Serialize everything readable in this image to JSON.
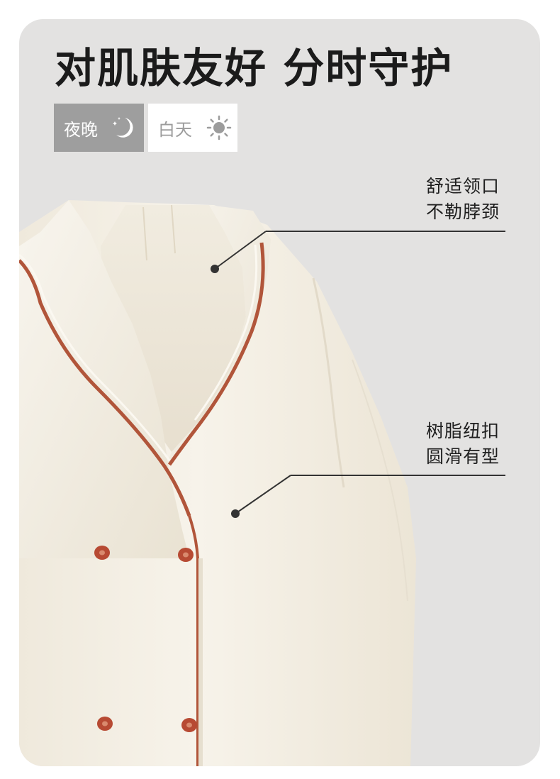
{
  "headline": "对肌肤友好  分时守护",
  "modes": [
    {
      "label": "夜晚",
      "icon": "moon-stars-icon",
      "active": true
    },
    {
      "label": "白天",
      "icon": "sun-icon",
      "active": false
    }
  ],
  "callouts": [
    {
      "line1": "舒适领口",
      "line2": "不勒脖颈"
    },
    {
      "line1": "树脂纽扣",
      "line2": "圆滑有型"
    }
  ],
  "colors": {
    "card_background": "#e3e2e1",
    "active_tab": "#9e9e9e",
    "inactive_tab": "#ffffff",
    "garment": "#f5f1e6",
    "piping": "#b1553a",
    "button": "#b74a33",
    "pointer": "#333333"
  }
}
